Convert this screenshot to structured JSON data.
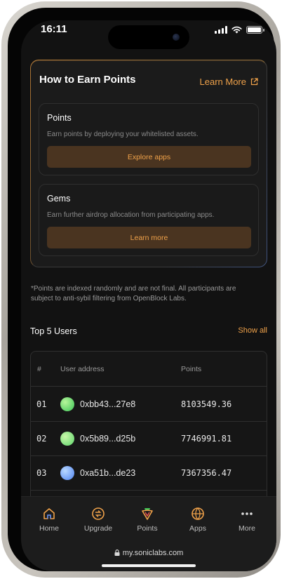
{
  "status": {
    "time": "16:11"
  },
  "earn": {
    "title": "How to Earn Points",
    "learn_more": "Learn More",
    "cards": [
      {
        "title": "Points",
        "description": "Earn points by deploying your whitelisted assets.",
        "button": "Explore apps"
      },
      {
        "title": "Gems",
        "description": "Earn further airdrop allocation from participating apps.",
        "button": "Learn more"
      }
    ]
  },
  "disclaimer": "*Points are indexed randomly and are not final. All participants are subject to anti-sybil filtering from OpenBlock Labs.",
  "leaderboard": {
    "title": "Top 5 Users",
    "show_all": "Show all",
    "columns": {
      "rank": "#",
      "address": "User address",
      "points": "Points"
    },
    "rows": [
      {
        "rank": "01",
        "address": "0xbb43...27e8",
        "points": "8103549.36"
      },
      {
        "rank": "02",
        "address": "0x5b89...d25b",
        "points": "7746991.81"
      },
      {
        "rank": "03",
        "address": "0xa51b...de23",
        "points": "7367356.47"
      }
    ]
  },
  "tabbar": [
    {
      "label": "Home",
      "icon": "home-icon"
    },
    {
      "label": "Upgrade",
      "icon": "upgrade-icon"
    },
    {
      "label": "Points",
      "icon": "points-icon"
    },
    {
      "label": "Apps",
      "icon": "apps-icon"
    },
    {
      "label": "More",
      "icon": "more-icon"
    }
  ],
  "browser": {
    "url": "my.soniclabs.com"
  },
  "colors": {
    "accent": "#f0a24a",
    "background": "#121212",
    "button_bg": "#4a3420"
  }
}
